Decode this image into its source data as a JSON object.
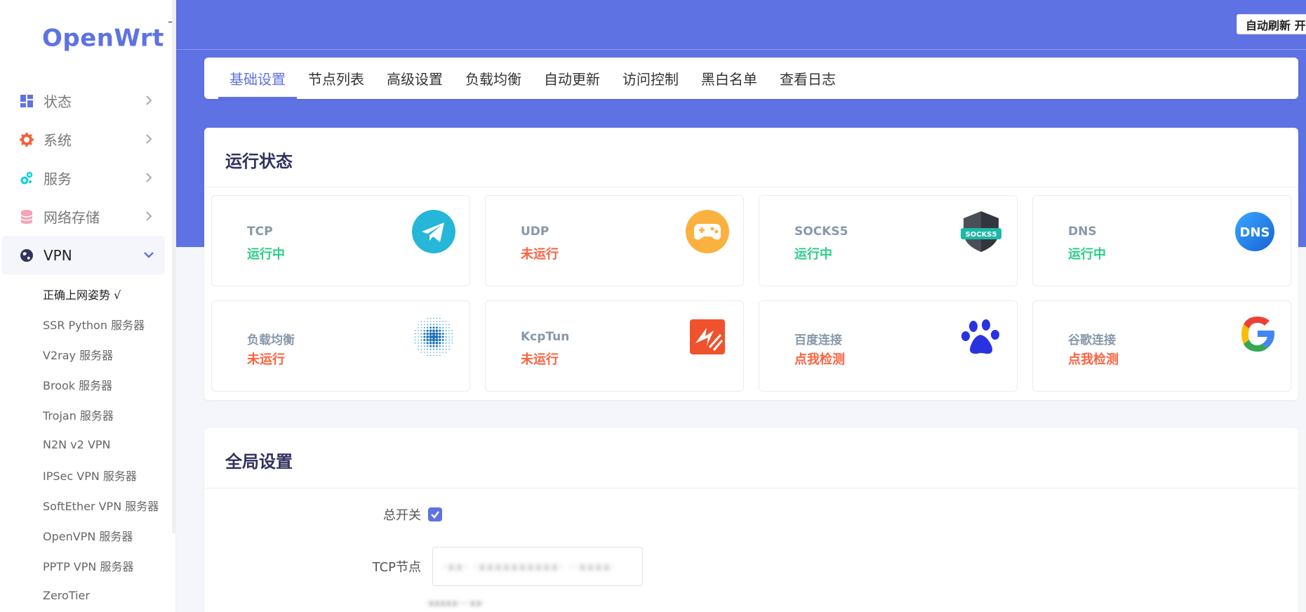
{
  "logo": {
    "text": "OpenWrt",
    "tm": "TM"
  },
  "sidebar": {
    "menu": [
      {
        "label": "状态",
        "icon": "dashboard-icon"
      },
      {
        "label": "系统",
        "icon": "gear-icon"
      },
      {
        "label": "服务",
        "icon": "gears-icon"
      },
      {
        "label": "网络存储",
        "icon": "database-icon"
      },
      {
        "label": "VPN",
        "icon": "globe-icon"
      }
    ],
    "vpn_items": [
      "正确上网姿势 √",
      "SSR Python 服务器",
      "V2ray 服务器",
      "Brook 服务器",
      "Trojan 服务器",
      "N2N v2 VPN",
      "IPSec VPN 服务器",
      "SoftEther VPN 服务器",
      "OpenVPN 服务器",
      "PPTP VPN 服务器",
      "ZeroTier"
    ]
  },
  "header": {
    "autorefresh": "自动刷新 开"
  },
  "tabs": [
    "基础设置",
    "节点列表",
    "高级设置",
    "负载均衡",
    "自动更新",
    "访问控制",
    "黑白名单",
    "查看日志"
  ],
  "status_section": {
    "title": "运行状态",
    "cards": [
      {
        "label": "TCP",
        "value": "运行中",
        "state": "ok",
        "icon": "telegram-icon"
      },
      {
        "label": "UDP",
        "value": "未运行",
        "state": "bad",
        "icon": "gamepad-icon"
      },
      {
        "label": "SOCKS5",
        "value": "运行中",
        "state": "ok",
        "icon": "socks5-shield-icon",
        "icon_text": "SOCKS5"
      },
      {
        "label": "DNS",
        "value": "运行中",
        "state": "ok",
        "icon": "dns-icon",
        "icon_text": "DNS"
      },
      {
        "label": "负载均衡",
        "value": "未运行",
        "state": "bad",
        "icon": "dots-sphere-icon"
      },
      {
        "label": "KcpTun",
        "value": "未运行",
        "state": "bad",
        "icon": "kcptun-icon"
      },
      {
        "label": "百度连接",
        "value": "点我检测",
        "state": "bad",
        "icon": "baidu-paw-icon"
      },
      {
        "label": "谷歌连接",
        "value": "点我检测",
        "state": "bad",
        "icon": "google-icon"
      }
    ]
  },
  "global_section": {
    "title": "全局设置",
    "master_switch_label": "总开关",
    "master_switch_checked": true,
    "tcp_node_label": "TCP节点",
    "tcp_node_value": "·xx· ·xxxxxxxxxx· ··xxxx·",
    "hint": "·xxxxx····xx·"
  },
  "colors": {
    "accent": "#5e72e4",
    "ok": "#2dce89",
    "bad": "#fb6340"
  }
}
